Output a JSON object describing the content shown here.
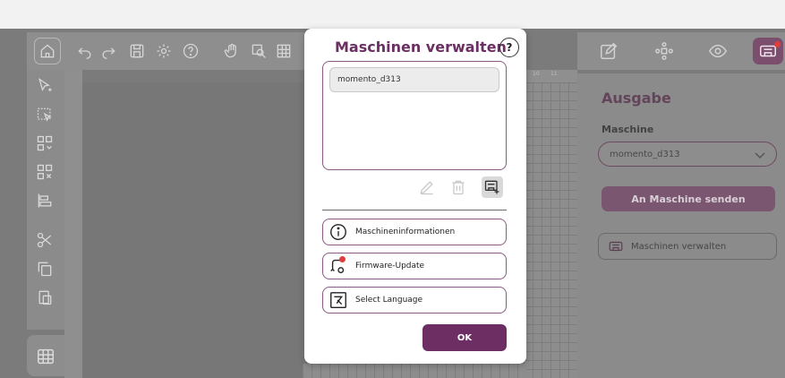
{
  "dialog": {
    "title": "Maschinen verwalten",
    "help_glyph": "?",
    "machines": [
      "momento_d313"
    ],
    "buttons": [
      {
        "label": "Maschineninformationen",
        "icon": "info-icon"
      },
      {
        "label": "Firmware-Update",
        "icon": "firmware-update-icon"
      },
      {
        "label": "Select Language",
        "icon": "language-icon"
      }
    ],
    "ok_label": "OK"
  },
  "right_panel": {
    "title": "Ausgabe",
    "machine_label": "Maschine",
    "selected_machine": "momento_d313",
    "send_label": "An Maschine senden",
    "manage_label": "Maschinen verwalten"
  },
  "canvas": {
    "ruler_ticks": [
      "10",
      "11"
    ]
  },
  "colors": {
    "accent": "#6d2e63",
    "title": "#6b2f63",
    "overlay": "#7b7b7b"
  }
}
